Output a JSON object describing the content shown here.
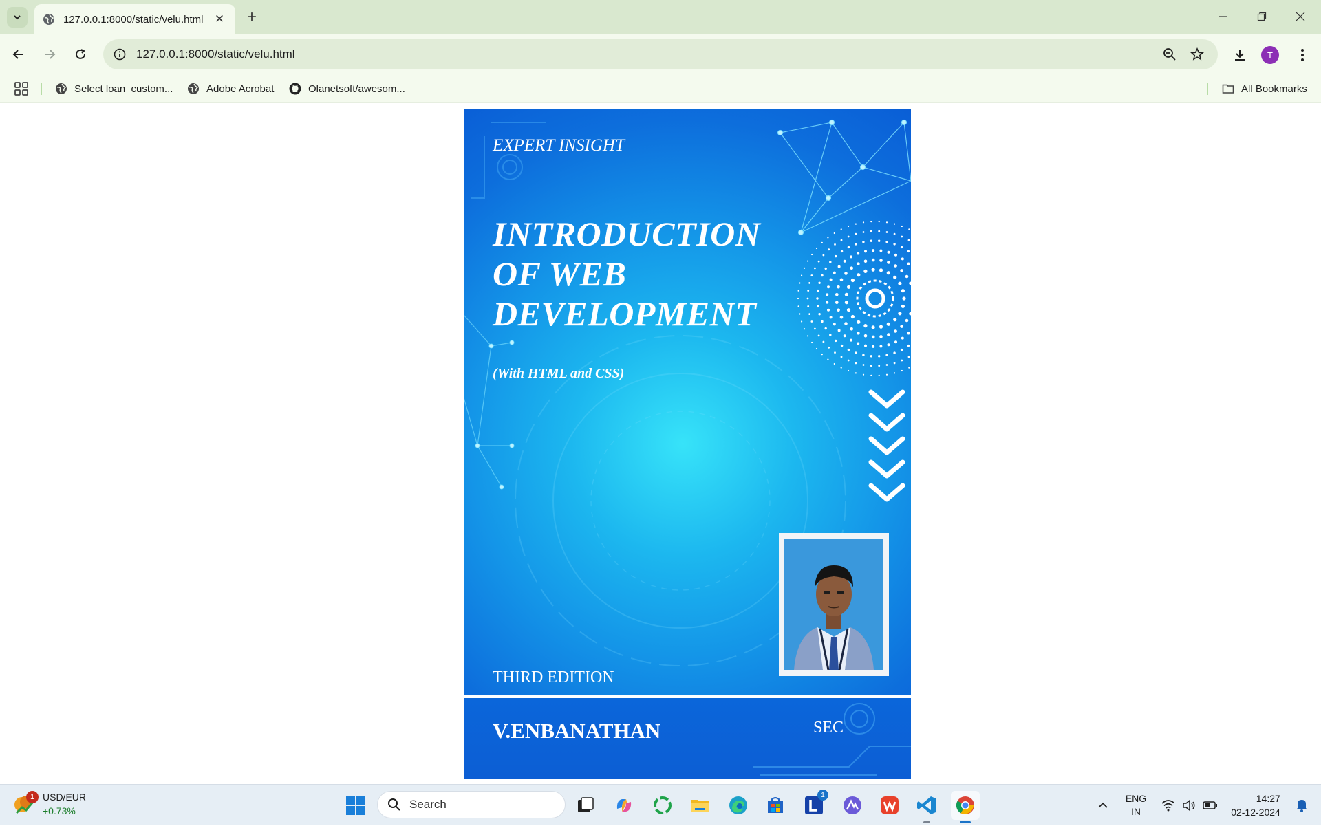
{
  "browser": {
    "tab": {
      "title": "127.0.0.1:8000/static/velu.html"
    },
    "omnibox": {
      "url": "127.0.0.1:8000/static/velu.html"
    },
    "profile_initial": "T",
    "bookmarks": [
      {
        "label": "Select loan_custom...",
        "icon": "globe-icon"
      },
      {
        "label": "Adobe Acrobat",
        "icon": "globe-icon"
      },
      {
        "label": "Olanetsoft/awesom...",
        "icon": "github-icon"
      }
    ],
    "all_bookmarks_label": "All Bookmarks"
  },
  "cover": {
    "eyebrow": "EXPERT INSIGHT",
    "title_lines": [
      "INTRODUCTION",
      "OF WEB",
      "DEVELOPMENT"
    ],
    "subtitle": "(With HTML and CSS)",
    "edition": "THIRD EDITION",
    "author": "V.ENBANATHAN",
    "institute": "SEC",
    "colors": {
      "background_center": "#37e3f9",
      "background_edge": "#0a5ed6",
      "text": "#ffffff"
    }
  },
  "taskbar": {
    "widget": {
      "title": "USD/EUR",
      "value": "+0.73%",
      "badge": "1"
    },
    "search_placeholder": "Search",
    "apps": [
      "task-view-icon",
      "copilot-icon",
      "refresh-app-icon",
      "file-explorer-icon",
      "edge-icon",
      "store-icon",
      "l-app-icon",
      "vector-app-icon",
      "wps-icon",
      "vscode-icon",
      "chrome-icon"
    ],
    "l_app_badge": "1",
    "language": {
      "line1": "ENG",
      "line2": "IN"
    },
    "time": "14:27",
    "date": "02-12-2024"
  }
}
